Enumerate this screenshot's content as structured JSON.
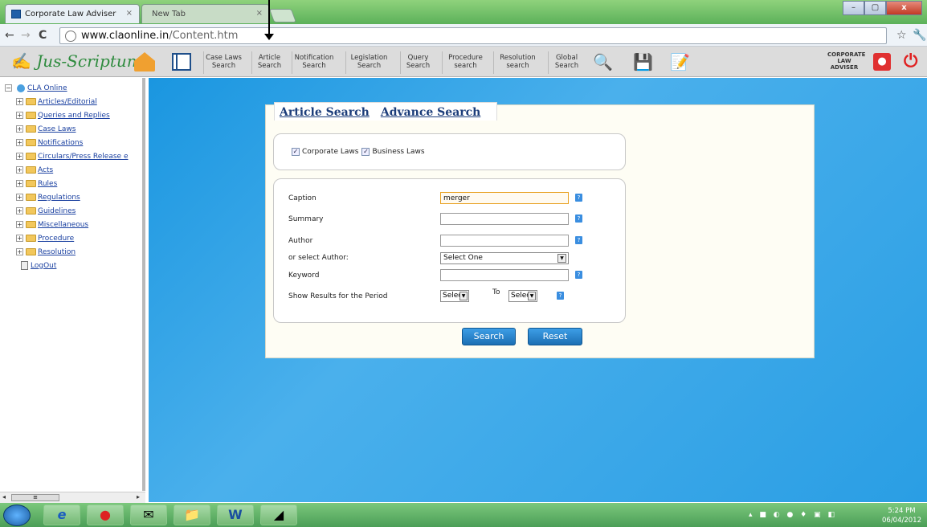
{
  "browser": {
    "tabs": [
      {
        "label": "Corporate Law Adviser",
        "close": "×"
      },
      {
        "label": "New Tab",
        "close": "×"
      }
    ],
    "url_domain": "www.claonline.in",
    "url_path": "/Content.htm",
    "window_buttons": [
      "–",
      "▢",
      "x"
    ]
  },
  "app": {
    "logo": "Jus-Scriptum",
    "toolbar": [
      {
        "line1": "Case Laws",
        "line2": "Search"
      },
      {
        "line1": "Article",
        "line2": "Search"
      },
      {
        "line1": "Notification",
        "line2": "Search"
      },
      {
        "line1": "Legislation",
        "line2": "Search"
      },
      {
        "line1": "Query",
        "line2": "Search"
      },
      {
        "line1": "Procedure",
        "line2": "search"
      },
      {
        "line1": "Resolution",
        "line2": "search"
      },
      {
        "line1": "Global",
        "line2": "Search"
      }
    ],
    "brand": {
      "line1": "CORPORATE",
      "line2": "LAW",
      "line3": "ADVISER"
    }
  },
  "sidebar": {
    "root": "CLA Online",
    "items": [
      "Articles/Editorial",
      "Queries and Replies",
      "Case Laws",
      "Notifications",
      "Circulars/Press Release e",
      "Acts",
      "Rules",
      "Regulations",
      "Guidelines",
      "Miscellaneous",
      "Procedure",
      "Resolution"
    ],
    "logout": "LogOut"
  },
  "form": {
    "tabs": [
      "Article Search",
      "Advance Search"
    ],
    "checkboxes": [
      "Corporate Laws",
      "Business Laws"
    ],
    "caption_label": "Caption",
    "caption_value": "merger",
    "summary_label": "Summary",
    "author_label": "Author",
    "select_author_label": "or select Author:",
    "select_author_value": "Select One",
    "keyword_label": "Keyword",
    "period_label": "Show Results for the Period",
    "period_from": "Select",
    "period_to_label": "To",
    "period_to": "Select",
    "search_button": "Search",
    "reset_button": "Reset",
    "help": "?"
  },
  "taskbar": {
    "time": "5:24 PM",
    "date": "06/04/2012"
  }
}
